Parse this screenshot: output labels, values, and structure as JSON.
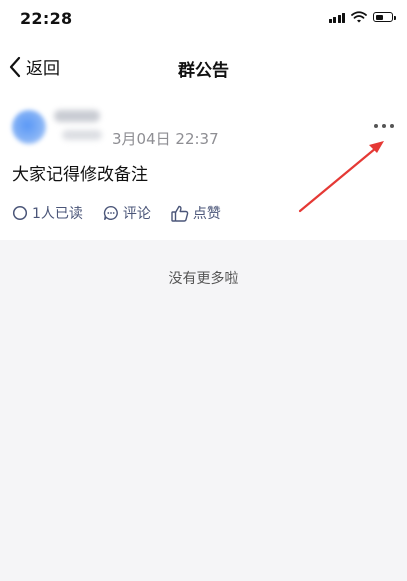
{
  "status_bar": {
    "time": "22:28",
    "battery_level": 0.55
  },
  "nav": {
    "back_label": "返回",
    "title": "群公告"
  },
  "post": {
    "timestamp": "3月04日 22:37",
    "content": "大家记得修改备注",
    "actions": [
      {
        "label": "1人已读",
        "icon": "circle-icon"
      },
      {
        "label": "评论",
        "icon": "comment-icon"
      },
      {
        "label": "点赞",
        "icon": "thumbs-up-icon"
      }
    ]
  },
  "footer": {
    "no_more_text": "没有更多啦"
  },
  "colors": {
    "accent": "#4a5578",
    "annotation": "#e53935",
    "background": "#f5f5f7"
  }
}
